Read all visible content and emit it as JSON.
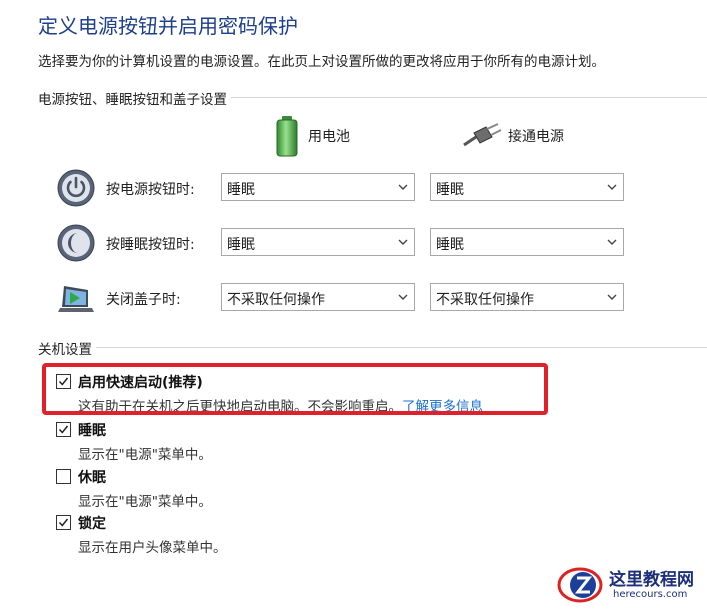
{
  "header": {
    "title": "定义电源按钮并启用密码保护",
    "subtitle": "选择要为你的计算机设置的电源设置。在此页上对设置所做的更改将应用于你所有的电源计划。"
  },
  "buttons_section": {
    "title": "电源按钮、睡眠按钮和盖子设置",
    "col_battery": "用电池",
    "col_ac": "接通电源",
    "rows": [
      {
        "label": "按电源按钮时:",
        "battery": "睡眠",
        "ac": "睡眠",
        "icon": "power-icon"
      },
      {
        "label": "按睡眠按钮时:",
        "battery": "睡眠",
        "ac": "睡眠",
        "icon": "sleep-icon"
      },
      {
        "label": "关闭盖子时:",
        "battery": "不采取任何操作",
        "ac": "不采取任何操作",
        "icon": "laptop-lid-icon"
      }
    ]
  },
  "shutdown_section": {
    "title": "关机设置",
    "options": [
      {
        "title": "启用快速启动(推荐)",
        "desc": "这有助于在关机之后更快地启动电脑。不会影响重启。",
        "link": "了解更多信息",
        "checked": true
      },
      {
        "title": "睡眠",
        "desc": "显示在\"电源\"菜单中。",
        "checked": true
      },
      {
        "title": "休眠",
        "desc": "显示在\"电源\"菜单中。",
        "checked": false
      },
      {
        "title": "锁定",
        "desc": "显示在用户头像菜单中。",
        "checked": true
      }
    ]
  },
  "watermark": {
    "title": "这里教程网",
    "url": "herecours.com"
  },
  "colors": {
    "title": "#1e3f8a",
    "link": "#1a6fcf",
    "highlight": "#e0202a"
  }
}
